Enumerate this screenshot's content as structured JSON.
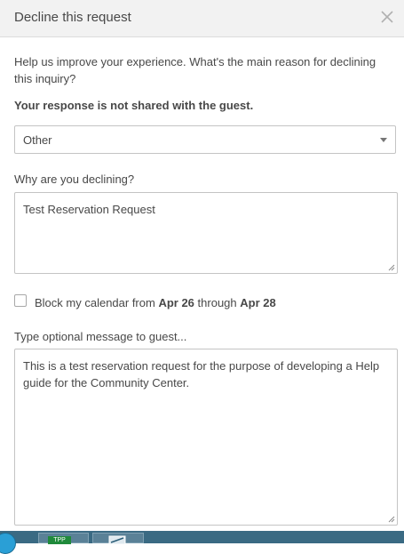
{
  "dialog": {
    "title": "Decline this request",
    "intro": "Help us improve your experience. What's the main reason for declining this inquiry?",
    "notice": "Your response is not shared with the guest.",
    "reason_select": {
      "selected": "Other"
    },
    "why_label": "Why are you declining?",
    "why_value": "Test Reservation Request",
    "block_calendar": {
      "checked": false,
      "prefix": "Block my calendar from",
      "from_date": "Apr 26",
      "through": "through",
      "to_date": "Apr 28"
    },
    "message_label": "Type optional message to guest...",
    "message_value": "This is a test reservation request for the purpose of developing a Help guide for the Community Center."
  },
  "taskbar": {
    "tpp_label": "TPP"
  },
  "colors": {
    "header_bg": "#f2f2f2",
    "text": "#484848",
    "border": "#c4c4c4",
    "taskbar": "#3a6a83"
  }
}
